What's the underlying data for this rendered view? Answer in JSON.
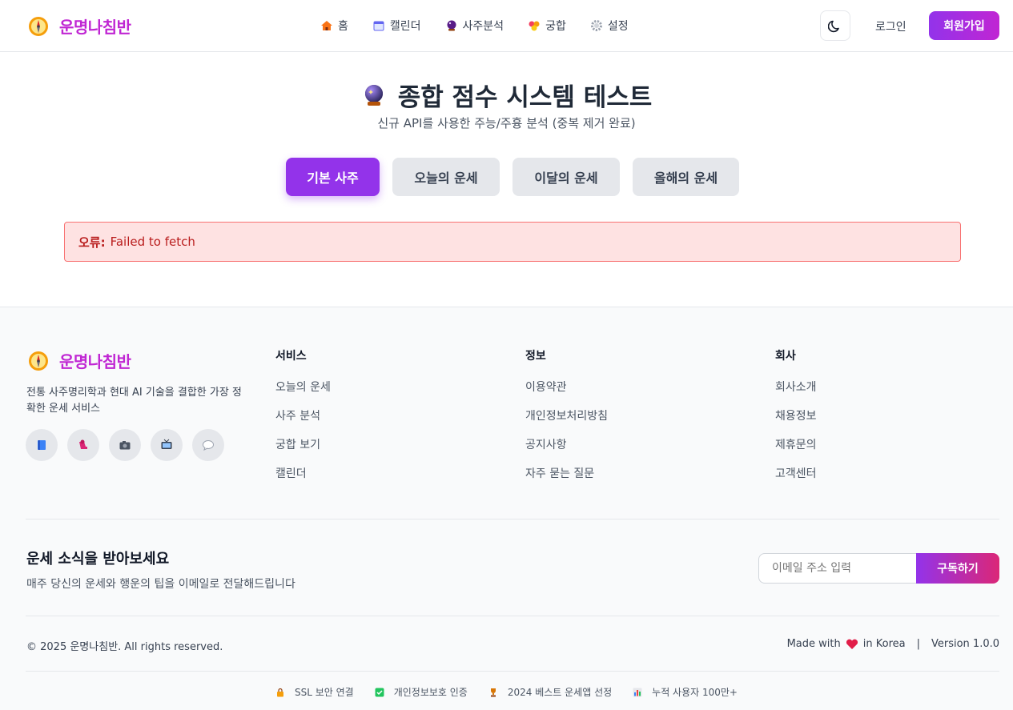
{
  "brand": {
    "name": "운명나침반"
  },
  "nav": [
    {
      "label": "홈",
      "icon": "house-icon"
    },
    {
      "label": "캘린더",
      "icon": "calendar-icon"
    },
    {
      "label": "사주분석",
      "icon": "crystal-ball-icon"
    },
    {
      "label": "궁합",
      "icon": "hearts-icon"
    },
    {
      "label": "설정",
      "icon": "gear-icon"
    }
  ],
  "header": {
    "login": "로그인",
    "signup": "회원가입"
  },
  "main": {
    "title": "종합 점수 시스템 테스트",
    "subtitle": "신규 API를 사용한 주능/주흉 분석 (중복 제거 완료)",
    "tabs": [
      "기본 사주",
      "오늘의 운세",
      "이달의 운세",
      "올해의 운세"
    ],
    "active_tab": "기본 사주",
    "error_label": "오류:",
    "error_message": "Failed to fetch"
  },
  "footer": {
    "description": "전통 사주명리학과 현대 AI 기술을 결합한 가장 정확한 운세 서비스",
    "socials": [
      "book-icon",
      "thread-icon",
      "camera-icon",
      "tv-icon",
      "speech-bubble-icon"
    ],
    "columns": [
      {
        "title": "서비스",
        "links": [
          "오늘의 운세",
          "사주 분석",
          "궁합 보기",
          "캘린더"
        ]
      },
      {
        "title": "정보",
        "links": [
          "이용약관",
          "개인정보처리방침",
          "공지사항",
          "자주 묻는 질문"
        ]
      },
      {
        "title": "회사",
        "links": [
          "회사소개",
          "채용정보",
          "제휴문의",
          "고객센터"
        ]
      }
    ],
    "newsletter": {
      "title": "운세 소식을 받아보세요",
      "description": "매주 당신의 운세와 행운의 팁을 이메일로 전달해드립니다",
      "placeholder": "이메일 주소 입력",
      "button": "구독하기"
    },
    "copyright": "© 2025 운명나침반. All rights reserved.",
    "made_with_prefix": "Made with",
    "made_with_suffix": "in Korea",
    "separator": "|",
    "version": "Version 1.0.0",
    "badges": [
      "SSL 보안 연결",
      "개인정보보호 인증",
      "2024 베스트 운세앱 선정",
      "누적 사용자 100만+"
    ]
  },
  "colors": {
    "brand": "#c026d3",
    "primary": "#9333ea",
    "error_bg": "#fee2e2",
    "error_text": "#b91c1c"
  }
}
